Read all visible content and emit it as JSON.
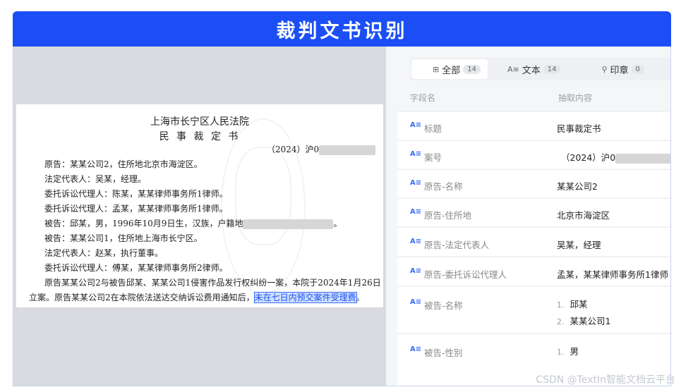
{
  "banner": {
    "title": "裁判文书识别"
  },
  "document": {
    "court": "上海市长宁区人民法院",
    "type": "民 事 裁 定 书",
    "case_no": "（2024）沪0",
    "lines": [
      "原告：某某公司2，住所地北京市海淀区。",
      "法定代表人：吴某，经理。",
      "委托诉讼代理人：陈某，某某律师事务所1律师。",
      "委托诉讼代理人：孟某，某某律师事务所1律师。",
      "被告：邱某，男，1996年10月9日生，汉族，户籍地",
      "被告：某某公司1，住所地上海市长宁区。",
      "法定代表人：赵某，执行董事。",
      "委托诉讼代理人：傅某，某某律师事务所2律师。",
      "原告某某公司2与被告邱某、某某公司1侵害作品发行权纠纷一案，本院于2024年1月26日",
      "立案。原告某某公司2在本院依法送达交纳诉讼费用通知后，"
    ],
    "line5_tail": "。",
    "highlight": "未在七日内预交案件受理费",
    "last_tail": "。"
  },
  "tabs": [
    {
      "label": "全部",
      "count": "14",
      "icon": "grid-icon"
    },
    {
      "label": "文本",
      "count": "14",
      "icon": "text-icon"
    },
    {
      "label": "印章",
      "count": "0",
      "icon": "stamp-icon"
    }
  ],
  "table": {
    "col_field": "字段名",
    "col_value": "抽取内容",
    "rows": [
      {
        "field": "标题",
        "value": "民事裁定书"
      },
      {
        "field": "案号",
        "value": "（2024）沪0"
      },
      {
        "field": "原告-名称",
        "value": "某某公司2"
      },
      {
        "field": "原告-住所地",
        "value": "北京市海淀区"
      },
      {
        "field": "原告-法定代表人",
        "value": "吴某，经理"
      },
      {
        "field": "原告-委托诉讼代理人",
        "value": "孟某，某某律师事务所1律师"
      },
      {
        "field": "被告-名称",
        "values": [
          "邱某",
          "某某公司1"
        ],
        "nums": [
          "1.",
          "2."
        ]
      },
      {
        "field": "被告-性别",
        "values": [
          "男"
        ],
        "nums": [
          "1."
        ]
      }
    ]
  },
  "watermark": "CSDN @TextIn智能文档云平台"
}
